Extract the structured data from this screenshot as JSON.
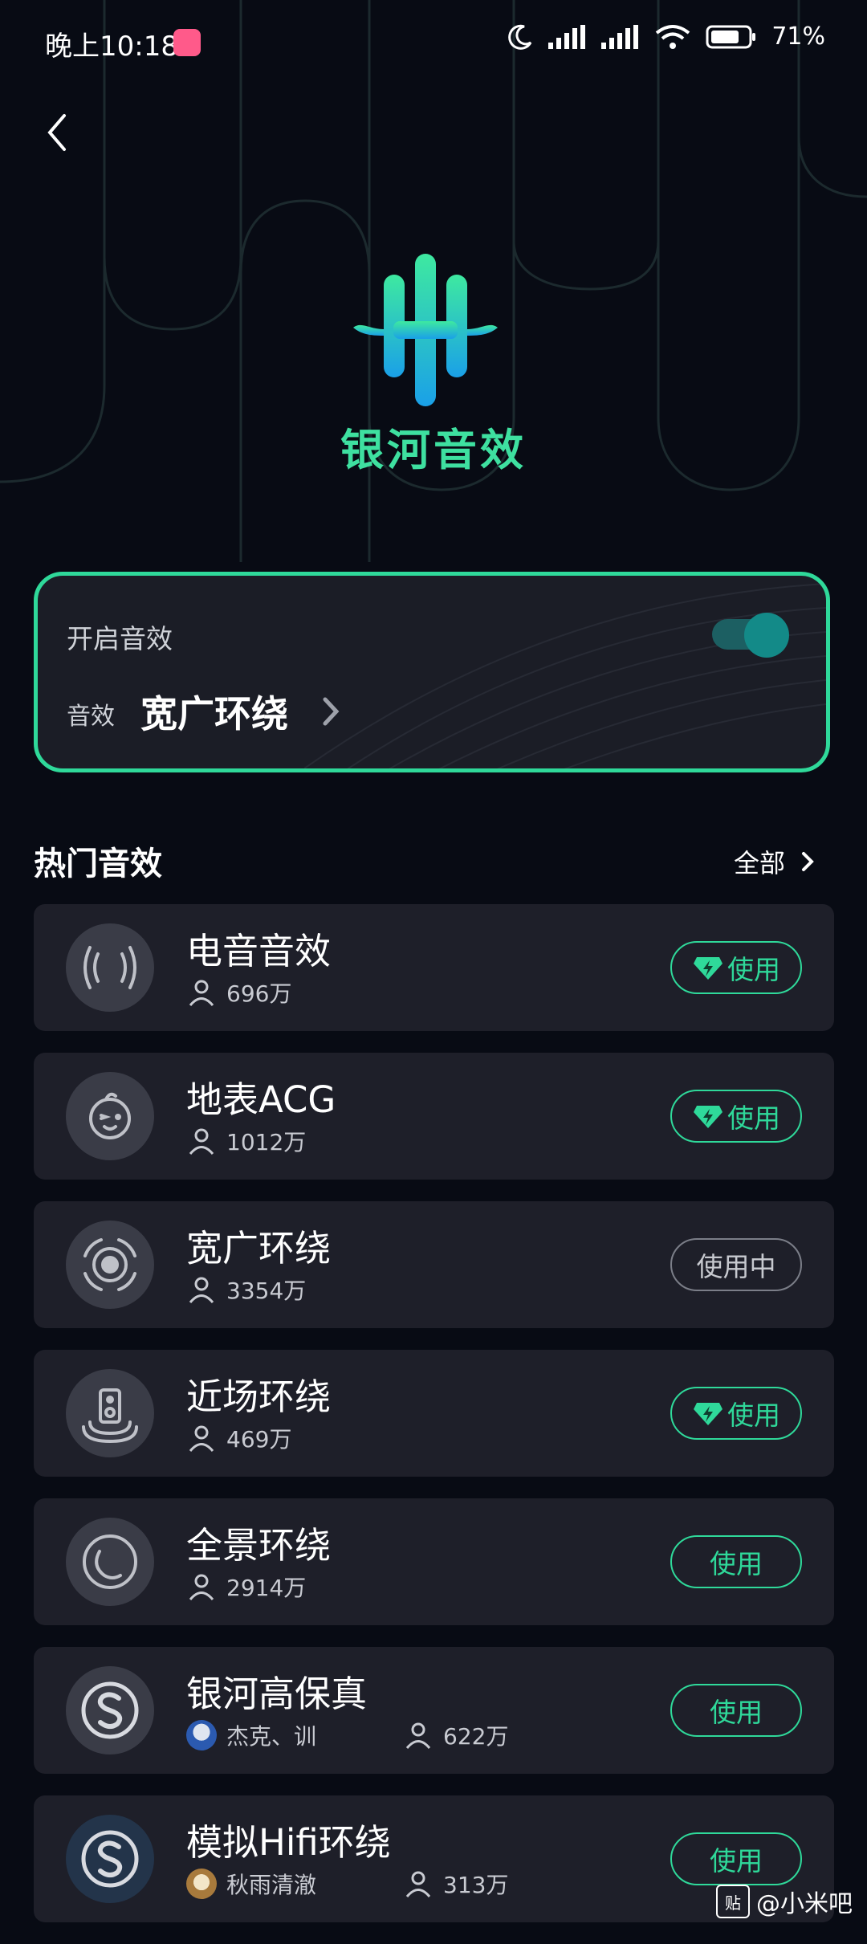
{
  "status_bar": {
    "time": "晚上10:18",
    "battery_pct": "71%",
    "bili_badge": "bilibili"
  },
  "header": {
    "app_title": "银河音效"
  },
  "effect_card": {
    "enable_label": "开启音效",
    "enabled": true,
    "effect_label": "音效",
    "current_effect": "宽广环绕"
  },
  "popular": {
    "title": "热门音效",
    "all_label": "全部",
    "items": [
      {
        "name": "电音音效",
        "users": "696万",
        "button": "使用",
        "vip": true,
        "icon": "sound-wave-icon"
      },
      {
        "name": "地表ACG",
        "users": "1012万",
        "button": "使用",
        "vip": true,
        "icon": "face-icon"
      },
      {
        "name": "宽广环绕",
        "users": "3354万",
        "button": "使用中",
        "vip": false,
        "icon": "surround-icon"
      },
      {
        "name": "近场环绕",
        "users": "469万",
        "button": "使用",
        "vip": true,
        "icon": "speaker-icon"
      },
      {
        "name": "全景环绕",
        "users": "2914万",
        "button": "使用",
        "vip": false,
        "icon": "panorama-icon"
      },
      {
        "name": "银河高保真",
        "author": "杰克、训",
        "users": "622万",
        "button": "使用",
        "vip": false,
        "icon": "s-logo-icon"
      },
      {
        "name": "模拟Hifi环绕",
        "author": "秋雨清澈",
        "users": "313万",
        "button": "使用",
        "vip": false,
        "icon": "s-logo-icon"
      }
    ]
  },
  "watermark": {
    "text": "@小米吧",
    "box": "贴"
  },
  "colors": {
    "accent": "#2fd99a",
    "background": "#080b14",
    "card": "#1e1f29"
  }
}
